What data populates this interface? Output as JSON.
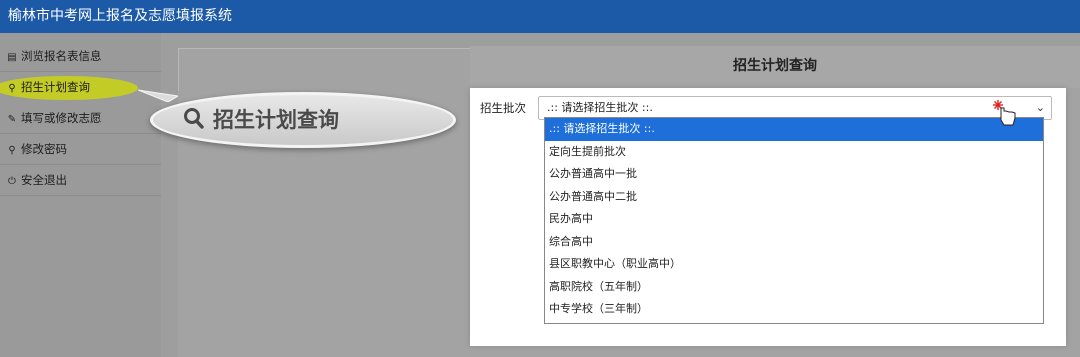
{
  "header": {
    "title": "榆林市中考网上报名及志愿填报系统"
  },
  "sidebar": {
    "items": [
      {
        "label": "浏览报名表信息",
        "icon": "document-icon"
      },
      {
        "label": "招生计划查询",
        "icon": "search-icon"
      },
      {
        "label": "填写或修改志愿",
        "icon": "pencil-icon"
      },
      {
        "label": "修改密码",
        "icon": "key-icon"
      },
      {
        "label": "安全退出",
        "icon": "power-icon"
      }
    ]
  },
  "main": {
    "page_title": "招生计划查询",
    "form": {
      "batch_label": "招生批次",
      "batch_select": {
        "value": ".:: 请选择招生批次 ::.",
        "options": [
          ".:: 请选择招生批次 ::.",
          "定向生提前批次",
          "公办普通高中一批",
          "公办普通高中二批",
          "民办高中",
          "综合高中",
          "县区职教中心（职业高中）",
          "高职院校（五年制）",
          "中专学校（三年制）"
        ]
      }
    }
  },
  "callout": {
    "text": "招生计划查询"
  },
  "colors": {
    "header_bg": "#1c5aa8",
    "highlight": "#c8d01a",
    "selected_option": "#1e6fd9"
  }
}
